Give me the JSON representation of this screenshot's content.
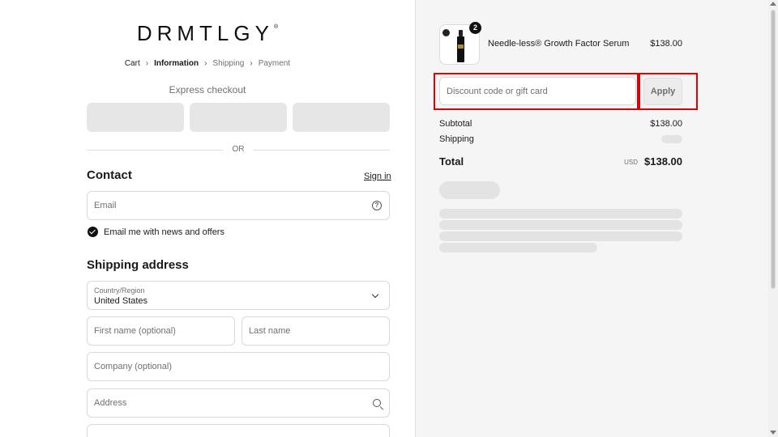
{
  "brand": {
    "logo": "DRMTLGY",
    "logo_mark": "®"
  },
  "breadcrumb": [
    {
      "label": "Cart"
    },
    {
      "label": "Information"
    },
    {
      "label": "Shipping"
    },
    {
      "label": "Payment"
    }
  ],
  "breadcrumb_sep": "›",
  "express": {
    "label": "Express checkout"
  },
  "divider": {
    "or": "OR"
  },
  "contact": {
    "heading": "Contact",
    "signin": "Sign in",
    "email_placeholder": "Email",
    "newsletter_label": "Email me with news and offers",
    "newsletter_checked": true
  },
  "shipping": {
    "heading": "Shipping address",
    "country_label": "Country/Region",
    "country_value": "United States",
    "first_name_placeholder": "First name (optional)",
    "last_name_placeholder": "Last name",
    "company_placeholder": "Company (optional)",
    "address_placeholder": "Address"
  },
  "order": {
    "item": {
      "name": "Needle-less® Growth Factor Serum",
      "price": "$138.00",
      "quantity": "2"
    },
    "discount_placeholder": "Discount code or gift card",
    "apply_label": "Apply",
    "subtotal_label": "Subtotal",
    "subtotal_value": "$138.00",
    "shipping_label": "Shipping",
    "total_label": "Total",
    "total_currency": "USD",
    "total_value": "$138.00"
  },
  "colors": {
    "highlight": "#e00000",
    "skeleton": "#e3e3e3"
  }
}
